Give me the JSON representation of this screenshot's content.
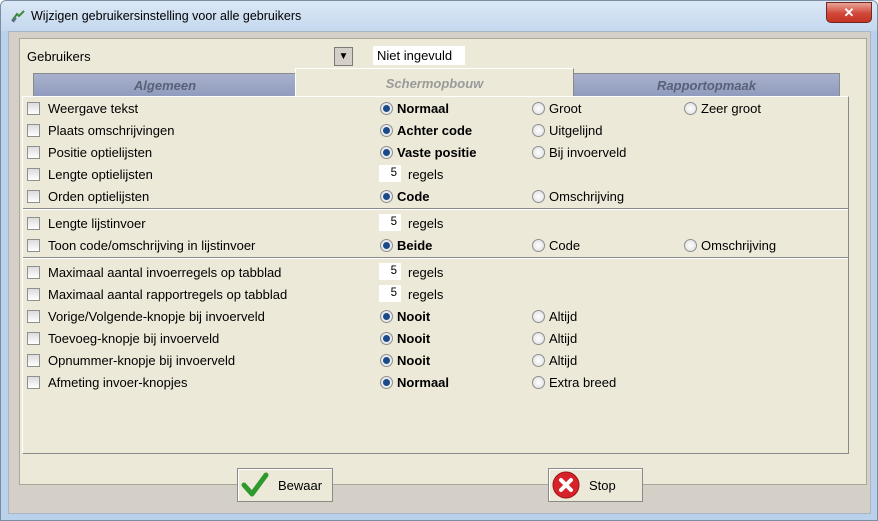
{
  "window": {
    "title": "Wijzigen gebruikersinstelling voor alle gebruikers",
    "close_label": "✕"
  },
  "users": {
    "label": "Gebruikers",
    "value": "Niet ingevuld",
    "dropdown_glyph": "▼"
  },
  "tabs": [
    {
      "label": "Algemeen",
      "active": false
    },
    {
      "label": "Schermopbouw",
      "active": true
    },
    {
      "label": "Rapportopmaak",
      "active": false
    }
  ],
  "rows": [
    {
      "label": "Weergave tekst",
      "options": [
        "Normaal",
        "Groot",
        "Zeer groot"
      ],
      "selected": 0
    },
    {
      "label": "Plaats omschrijvingen",
      "options": [
        "Achter code",
        "Uitgelijnd"
      ],
      "selected": 0
    },
    {
      "label": "Positie optielijsten",
      "options": [
        "Vaste positie",
        "Bij invoerveld"
      ],
      "selected": 0
    },
    {
      "label": "Lengte optielijsten",
      "number": "5",
      "unit": "regels"
    },
    {
      "label": "Orden optielijsten",
      "options": [
        "Code",
        "Omschrijving"
      ],
      "selected": 0
    },
    {
      "label": "Lengte lijstinvoer",
      "number": "5",
      "unit": "regels"
    },
    {
      "label": "Toon code/omschrijving in lijstinvoer",
      "options": [
        "Beide",
        "Code",
        "Omschrijving"
      ],
      "selected": 0
    },
    {
      "label": "Maximaal aantal invoerregels op tabblad",
      "number": "5",
      "unit": "regels"
    },
    {
      "label": "Maximaal aantal rapportregels op tabblad",
      "number": "5",
      "unit": "regels"
    },
    {
      "label": "Vorige/Volgende-knopje bij invoerveld",
      "options": [
        "Nooit",
        "Altijd"
      ],
      "selected": 0
    },
    {
      "label": "Toevoeg-knopje bij invoerveld",
      "options": [
        "Nooit",
        "Altijd"
      ],
      "selected": 0
    },
    {
      "label": "Opnummer-knopje bij invoerveld",
      "options": [
        "Nooit",
        "Altijd"
      ],
      "selected": 0
    },
    {
      "label": "Afmeting invoer-knopjes",
      "options": [
        "Normaal",
        "Extra breed"
      ],
      "selected": 0
    }
  ],
  "buttons": {
    "save": "Bewaar",
    "stop": "Stop"
  },
  "icons": {
    "save": "checkmark-icon",
    "stop": "stop-x-icon"
  },
  "colors": {
    "accent": "#1a4a8a",
    "save_icon": "#2e9a2e",
    "stop_icon": "#d8222a"
  }
}
